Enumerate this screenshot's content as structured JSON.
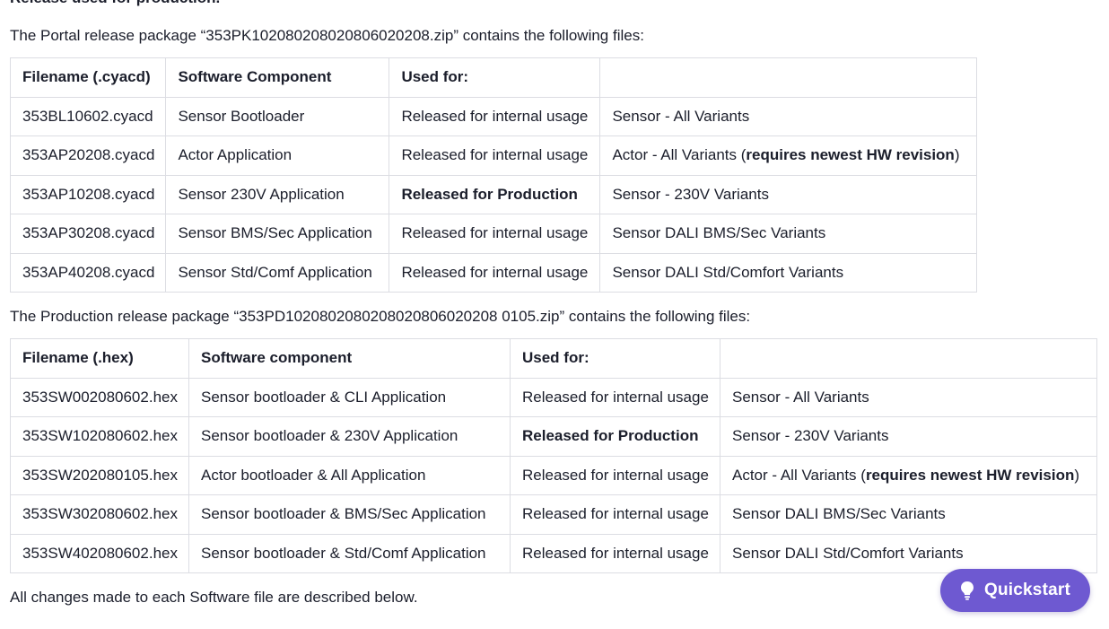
{
  "heading": "Release used for production.",
  "portal": {
    "intro": "The Portal release package “353PK102080208020806020208.zip” contains the following files:",
    "headers": [
      "Filename (.cyacd)",
      "Software Component",
      "Used for:",
      ""
    ],
    "rows": [
      {
        "file": "353BL10602.cyacd",
        "component": "Sensor Bootloader",
        "usage": "Released for internal usage",
        "variant": "Sensor - All Variants"
      },
      {
        "file": "353AP20208.cyacd",
        "component": "Actor Application",
        "usage": "Released for internal usage",
        "variant_pre": "Actor - All Variants (",
        "variant_bold": "requires newest HW revision",
        "variant_post": ")"
      },
      {
        "file": "353AP10208.cyacd",
        "component": "Sensor 230V Application",
        "usage_bold": "Released for Production",
        "variant": "Sensor - 230V Variants"
      },
      {
        "file": "353AP30208.cyacd",
        "component": "Sensor BMS/Sec Application",
        "usage": "Released for internal usage",
        "variant": "Sensor DALI BMS/Sec Variants"
      },
      {
        "file": "353AP40208.cyacd",
        "component": "Sensor Std/Comf Application",
        "usage": "Released for internal usage",
        "variant": "Sensor DALI Std/Comfort Variants"
      }
    ]
  },
  "production": {
    "intro": "The Production release package “353PD1020802080208020806020208 0105.zip” contains the following files:",
    "headers": [
      "Filename (.hex)",
      "Software component",
      "Used for:",
      ""
    ],
    "rows": [
      {
        "file": "353SW002080602.hex",
        "component": "Sensor bootloader & CLI Application",
        "usage": "Released for internal usage",
        "variant": "Sensor - All Variants"
      },
      {
        "file": "353SW102080602.hex",
        "component": "Sensor bootloader & 230V Application",
        "usage_bold": "Released for Production",
        "variant": "Sensor - 230V Variants"
      },
      {
        "file": "353SW202080105.hex",
        "component": "Actor bootloader & All Application",
        "usage": "Released for internal usage",
        "variant_pre": "Actor - All Variants (",
        "variant_bold": "requires newest HW revision",
        "variant_post": ")"
      },
      {
        "file": "353SW302080602.hex",
        "component": "Sensor bootloader & BMS/Sec Application",
        "usage": "Released for internal usage",
        "variant": "Sensor DALI BMS/Sec Variants"
      },
      {
        "file": "353SW402080602.hex",
        "component": "Sensor bootloader & Std/Comf Application",
        "usage": "Released for internal usage",
        "variant": "Sensor DALI Std/Comfort Variants"
      }
    ]
  },
  "footer_text": "All changes made to each Software file are described below.",
  "quickstart": {
    "label": "Quickstart",
    "icon": "lightbulb-icon",
    "color": "#6e59d1"
  }
}
